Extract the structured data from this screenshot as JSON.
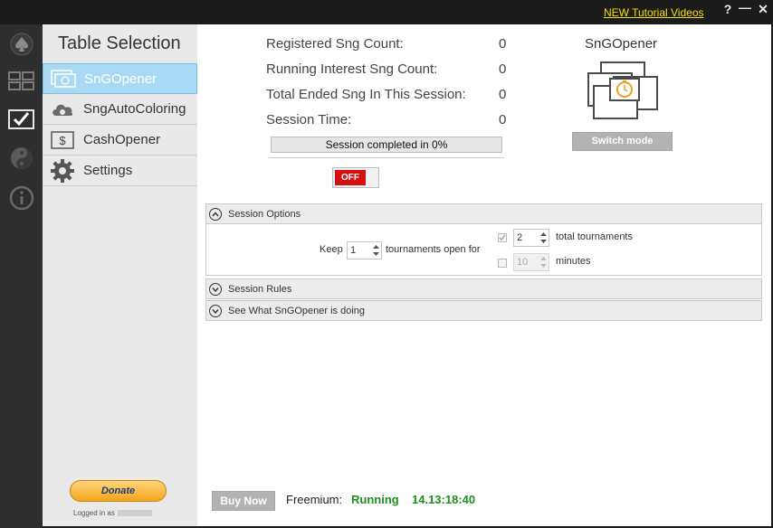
{
  "titlebar": {
    "tutorial_link": "NEW Tutorial Videos",
    "help_label": "?",
    "minimize_label": "—",
    "close_label": "✕"
  },
  "rail": {
    "items": [
      {
        "icon": "spade-icon"
      },
      {
        "icon": "tables-grid-icon"
      },
      {
        "icon": "checkmark-icon"
      },
      {
        "icon": "yin-yang-icon"
      },
      {
        "icon": "info-icon"
      }
    ]
  },
  "sidebar": {
    "title": "Table Selection",
    "items": [
      {
        "label": "SnGOpener",
        "icon": "sng-opener-icon",
        "active": true
      },
      {
        "label": "SngAutoColoring",
        "icon": "cloud-icon",
        "active": false
      },
      {
        "label": "CashOpener",
        "icon": "dollar-icon",
        "active": false
      },
      {
        "label": "Settings",
        "icon": "gear-icon",
        "active": false
      }
    ],
    "donate_label": "Donate",
    "logged_in_label": "Logged in as"
  },
  "stats": [
    {
      "label": "Registered Sng Count:",
      "value": "0"
    },
    {
      "label": "Running Interest Sng Count:",
      "value": "0"
    },
    {
      "label": "Total Ended Sng In This Session:",
      "value": "0"
    },
    {
      "label": "Session Time:",
      "value": "0"
    }
  ],
  "progress": {
    "text": "Session completed in 0%",
    "fraction": 0
  },
  "toggle": {
    "label": "OFF"
  },
  "mode": {
    "title": "SnGOpener",
    "switch_label": "Switch mode"
  },
  "session_options": {
    "title": "Session Options",
    "keep_label": "Keep",
    "keep_value": "1",
    "tournaments_open_label": "tournaments open for",
    "total_value": "2",
    "total_label": "total tournaments",
    "total_checked": true,
    "minutes_value": "10",
    "minutes_label": "minutes",
    "minutes_checked": false
  },
  "session_rules": {
    "title": "Session Rules"
  },
  "activity": {
    "title": "See What SnGOpener is doing"
  },
  "footer": {
    "buy_now": "Buy Now",
    "plan_label": "Freemium:",
    "plan_status": "Running",
    "plan_timer": "14.13:18:40"
  },
  "colors": {
    "accent": "#a9d9f3",
    "status_green": "#1d8f1d",
    "toggle_off": "#d41010",
    "link_yellow": "#f2e100"
  }
}
